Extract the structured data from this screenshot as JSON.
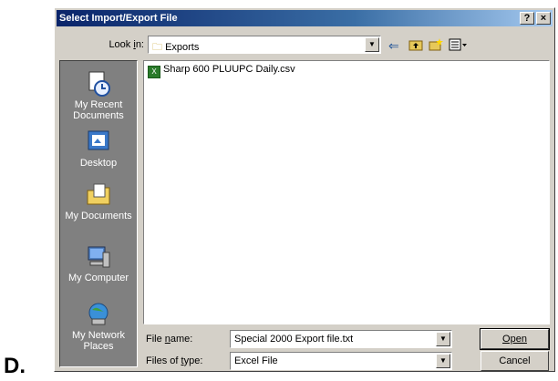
{
  "doc_label": "D.",
  "window": {
    "title": "Select Import/Export File",
    "help_btn": "?",
    "close_btn": "×"
  },
  "lookin": {
    "label": "Look in:",
    "value": "Exports"
  },
  "places": [
    {
      "label": "My Recent Documents",
      "icon": "recent-documents-icon"
    },
    {
      "label": "Desktop",
      "icon": "desktop-icon"
    },
    {
      "label": "My Documents",
      "icon": "my-documents-icon"
    },
    {
      "label": "My Computer",
      "icon": "my-computer-icon"
    },
    {
      "label": "My Network Places",
      "icon": "network-places-icon"
    }
  ],
  "files": [
    {
      "name": "Sharp 600 PLUUPC Daily.csv",
      "icon": "excel-csv-icon"
    }
  ],
  "filename": {
    "label": "File name:",
    "value": "Special 2000 Export file.txt"
  },
  "filetype": {
    "label": "Files of type:",
    "value": "Excel File"
  },
  "buttons": {
    "open": "Open",
    "cancel": "Cancel"
  }
}
